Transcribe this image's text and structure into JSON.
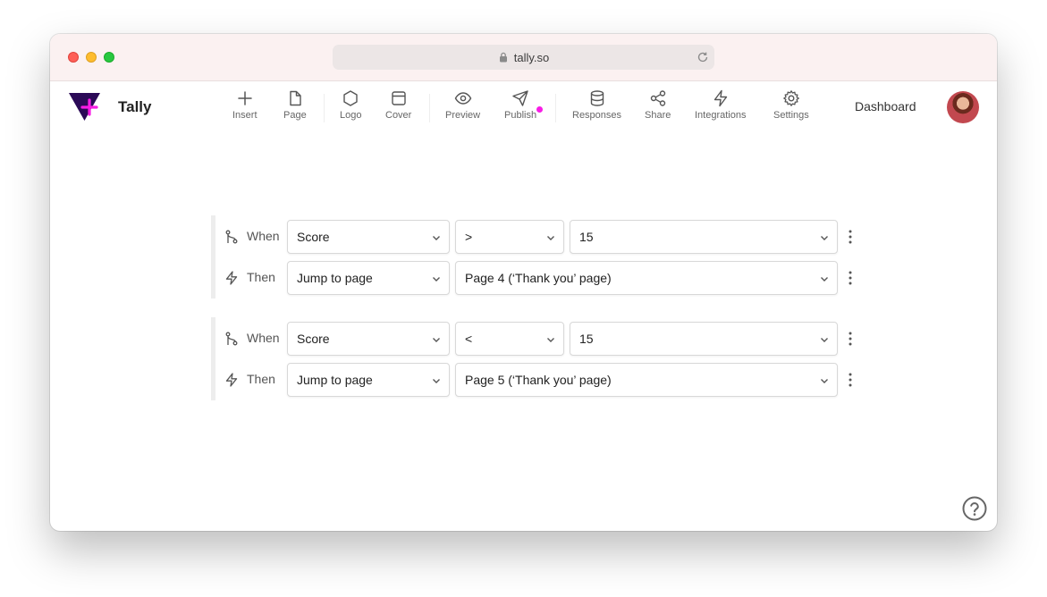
{
  "browser": {
    "url": "tally.so"
  },
  "brand": {
    "name": "Tally",
    "accent": "#f81ce5",
    "logo_color": "#2b0a57"
  },
  "toolbar": {
    "items": [
      {
        "label": "Insert",
        "icon": "plus-icon"
      },
      {
        "label": "Page",
        "icon": "page-icon"
      },
      {
        "label": "Logo",
        "icon": "hexagon-icon"
      },
      {
        "label": "Cover",
        "icon": "cover-icon"
      },
      {
        "label": "Preview",
        "icon": "eye-icon"
      },
      {
        "label": "Publish",
        "icon": "send-icon"
      },
      {
        "label": "Responses",
        "icon": "database-icon"
      },
      {
        "label": "Share",
        "icon": "share-icon"
      },
      {
        "label": "Integrations",
        "icon": "lightning-icon"
      },
      {
        "label": "Settings",
        "icon": "gear-icon"
      }
    ],
    "dashboard": "Dashboard"
  },
  "rules": [
    {
      "when": {
        "label": "When",
        "field": "Score",
        "operator": ">",
        "value": "15"
      },
      "then": {
        "label": "Then",
        "action": "Jump to page",
        "target": "Page 4 (‘Thank you’ page)"
      }
    },
    {
      "when": {
        "label": "When",
        "field": "Score",
        "operator": "<",
        "value": "15"
      },
      "then": {
        "label": "Then",
        "action": "Jump to page",
        "target": "Page 5 (‘Thank you’ page)"
      }
    }
  ]
}
